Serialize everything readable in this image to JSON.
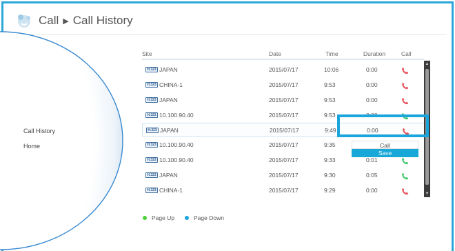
{
  "breadcrumb": {
    "root": "Call",
    "page": "Call History"
  },
  "sidebar": {
    "items": [
      {
        "label": "Call History"
      },
      {
        "label": "Home"
      }
    ]
  },
  "table": {
    "columns": {
      "site": "Site",
      "date": "Date",
      "time": "Time",
      "duration": "Duration",
      "call": "Call"
    },
    "codec_badge": "H.323",
    "rows": [
      {
        "site": "JAPAN",
        "date": "2015/07/17",
        "time": "10:06",
        "duration": "0:00",
        "status": "missed"
      },
      {
        "site": "CHINA-1",
        "date": "2015/07/17",
        "time": "9:53",
        "duration": "0:00",
        "status": "missed"
      },
      {
        "site": "JAPAN",
        "date": "2015/07/17",
        "time": "9:53",
        "duration": "0:00",
        "status": "missed"
      },
      {
        "site": "10.100.90.40",
        "date": "2015/07/17",
        "time": "9:53",
        "duration": "0:00",
        "status": "outgoing"
      },
      {
        "site": "JAPAN",
        "date": "2015/07/17",
        "time": "9:49",
        "duration": "0:00",
        "status": "missed",
        "selected": true
      },
      {
        "site": "10.100.90.40",
        "date": "2015/07/17",
        "time": "9:35",
        "duration": "",
        "status": "outgoing"
      },
      {
        "site": "10.100.90.40",
        "date": "2015/07/17",
        "time": "9:33",
        "duration": "0:01",
        "status": "outgoing"
      },
      {
        "site": "JAPAN",
        "date": "2015/07/17",
        "time": "9:30",
        "duration": "0:05",
        "status": "outgoing"
      },
      {
        "site": "CHINA-1",
        "date": "2015/07/17",
        "time": "9:29",
        "duration": "0:00",
        "status": "missed"
      }
    ]
  },
  "context_menu": {
    "items": [
      {
        "label": "Call"
      },
      {
        "label": "Save"
      }
    ],
    "active_index": 1
  },
  "legend": {
    "page_up": "Page Up",
    "page_down": "Page Down"
  },
  "colors": {
    "accent": "#1aa5dc",
    "missed": "#e8525a",
    "outgoing": "#3fc66a",
    "page_up_dot": "#4cd137",
    "page_down_dot": "#1aa5dc"
  }
}
